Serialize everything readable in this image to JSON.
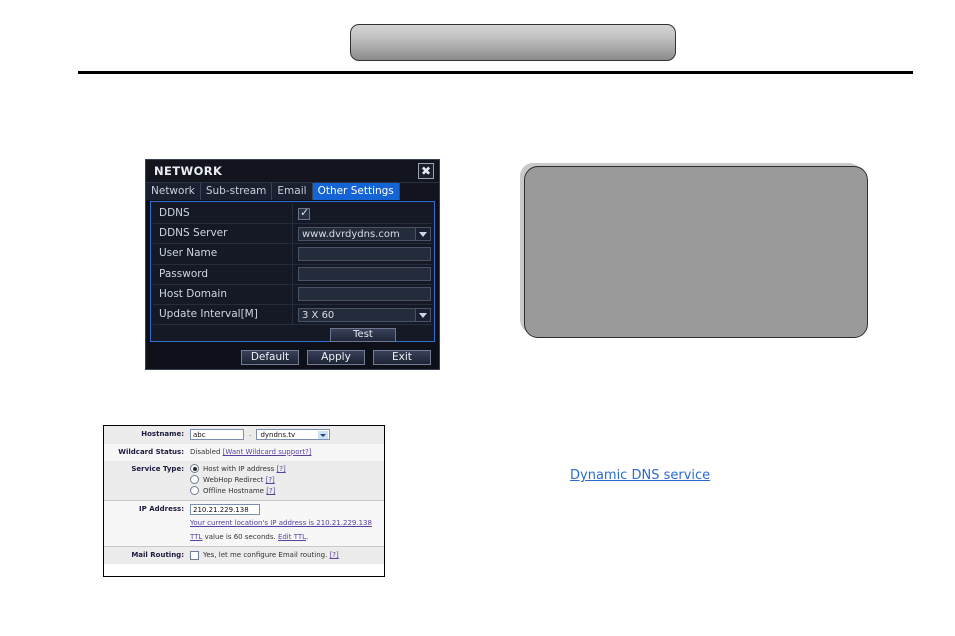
{
  "page": {
    "header_placeholder": "",
    "callout_placeholder": ""
  },
  "dvr_dialog": {
    "title": "NETWORK",
    "close_icon": "close-icon",
    "tabs": [
      {
        "label": "Network",
        "active": false
      },
      {
        "label": "Sub-stream",
        "active": false
      },
      {
        "label": "Email",
        "active": false
      },
      {
        "label": "Other Settings",
        "active": true
      }
    ],
    "rows": {
      "ddns": {
        "label": "DDNS",
        "checked": true
      },
      "ddns_server": {
        "label": "DDNS Server",
        "value": "www.dvrdydns.com"
      },
      "user_name": {
        "label": "User Name",
        "value": ""
      },
      "password": {
        "label": "Password",
        "value": ""
      },
      "host_domain": {
        "label": "Host Domain",
        "value": ""
      },
      "update_interval": {
        "label": "Update Interval[M]",
        "value": "3 X 60"
      }
    },
    "test_button": "Test",
    "footer_buttons": {
      "default": "Default",
      "apply": "Apply",
      "exit": "Exit"
    },
    "accent_color": "#1464d6"
  },
  "dyndns_form": {
    "hostname": {
      "label": "Hostname:",
      "value": "abc",
      "separator": ".",
      "domain_selected": "dyndns.tv"
    },
    "wildcard": {
      "label": "Wildcard Status:",
      "status": "Disabled",
      "link": "[Want Wildcard support?]"
    },
    "service_type": {
      "label": "Service Type:",
      "options": [
        {
          "label": "Host with IP address",
          "help": "[?]",
          "selected": true
        },
        {
          "label": "WebHop Redirect",
          "help": "[?]",
          "selected": false
        },
        {
          "label": "Offline Hostname",
          "help": "[?]",
          "selected": false
        }
      ]
    },
    "ip_address": {
      "label": "IP Address:",
      "value": "210.21.229.138",
      "current_ip_link": "Your current location's IP address is 210.21.229.138",
      "ttl_link": "TTL",
      "ttl_text": " value is 60 seconds. ",
      "edit_ttl_link": "Edit TTL",
      "ttl_tail": "."
    },
    "mail_routing": {
      "label": "Mail Routing:",
      "checked": false,
      "text": "Yes, let me configure Email routing.",
      "help": "[?]"
    }
  },
  "links": {
    "dynamic_dns_service": "Dynamic DNS service"
  }
}
